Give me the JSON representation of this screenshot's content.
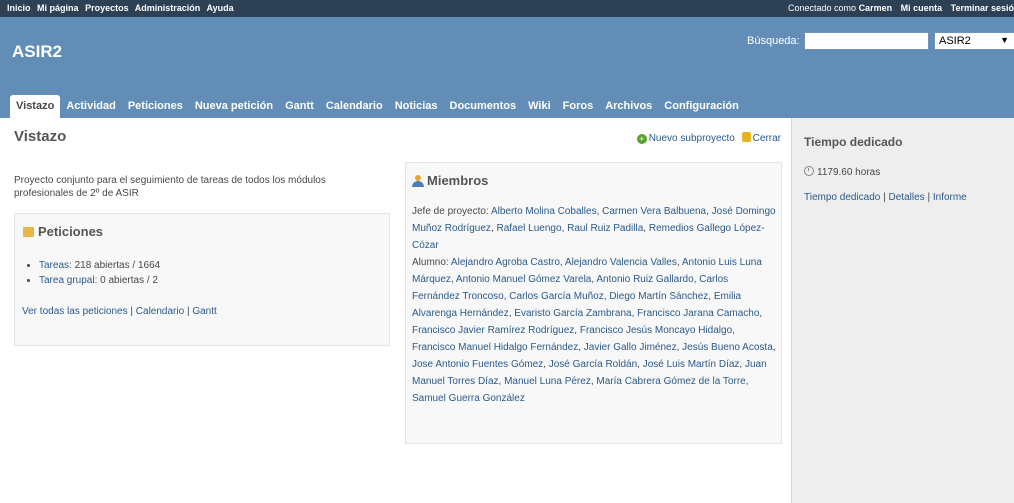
{
  "top_menu": {
    "left": [
      "Inicio",
      "Mi página",
      "Proyectos",
      "Administración",
      "Ayuda"
    ],
    "logged_prefix": "Conectado como",
    "logged_user": "Carmen",
    "my_account": "Mi cuenta",
    "logout": "Terminar sesió"
  },
  "header": {
    "title": "ASIR2",
    "search_label": "Búsqueda:",
    "search_value": "",
    "project_select": "ASIR2"
  },
  "main_menu": [
    "Vistazo",
    "Actividad",
    "Peticiones",
    "Nueva petición",
    "Gantt",
    "Calendario",
    "Noticias",
    "Documentos",
    "Wiki",
    "Foros",
    "Archivos",
    "Configuración"
  ],
  "page": {
    "title": "Vistazo",
    "new_subproject": "Nuevo subproyecto",
    "close": "Cerrar",
    "description": "Proyecto conjunto para el seguimiento de tareas de todos los módulos profesionales de 2º de ASIR"
  },
  "issues": {
    "title": "Peticiones",
    "items": [
      {
        "tracker": "Tareas",
        "text": ": 218 abiertas / 1664"
      },
      {
        "tracker": "Tarea grupal",
        "text": ": 0 abiertas / 2"
      }
    ],
    "link_all": "Ver todas las peticiones",
    "link_calendar": "Calendario",
    "link_gantt": "Gantt"
  },
  "members": {
    "title": "Miembros",
    "manager_label": "Jefe de proyecto:",
    "managers": [
      "Alberto Molina Coballes",
      "Carmen Vera Balbuena",
      "José Domingo Muñoz Rodríguez",
      "Rafael Luengo",
      "Raul Ruiz Padilla",
      "Remedios Gallego López-Cózar"
    ],
    "student_label": "Alumno:",
    "students": [
      "Alejandro Agroba Castro",
      "Alejandro Valencia Valles",
      "Antonio Luis Luna Márquez",
      "Antonio Manuel Gómez Varela",
      "Antonio Ruiz Gallardo",
      "Carlos Fernández Troncoso",
      "Carlos García Muñoz",
      "Diego Martín Sánchez",
      "Emilia Alvarenga Hernández",
      "Evaristo García Zambrana",
      "Francisco Jarana Camacho",
      "Francisco Javier Ramírez Rodríguez",
      "Francisco Jesús Moncayo Hidalgo",
      "Francisco Manuel Hidalgo Fernández",
      "Javier Gallo Jiménez",
      "Jesús Bueno Acosta",
      "Jose Antonio Fuentes Gómez",
      "José García Roldán",
      "José Luis Martín Díaz",
      "Juan Manuel Torres Díaz",
      "Manuel Luna Pérez",
      "María Cabrera Gómez de la Torre",
      "Samuel Guerra González"
    ]
  },
  "sidebar": {
    "title": "Tiempo dedicado",
    "hours": "1179.60 horas",
    "link_spent": "Tiempo dedicado",
    "link_details": "Detalles",
    "link_report": "Informe"
  }
}
